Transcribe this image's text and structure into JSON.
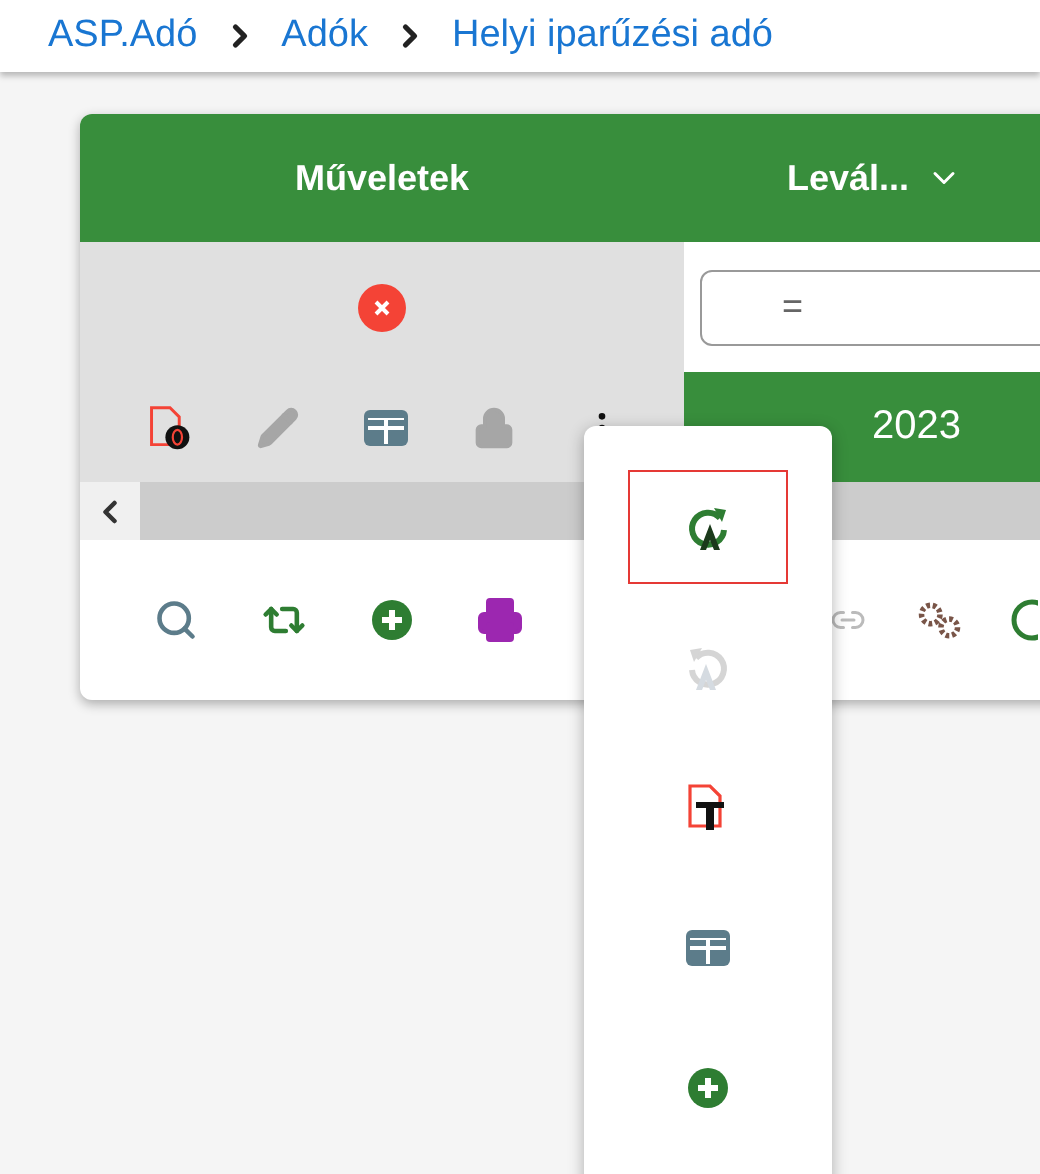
{
  "breadcrumb": [
    {
      "label": "ASP.Adó"
    },
    {
      "label": "Adók"
    },
    {
      "label": "Helyi iparűzési adó"
    }
  ],
  "table": {
    "columns": [
      {
        "label": "Műveletek"
      },
      {
        "label": "Levál..."
      }
    ],
    "row_actions": [
      {
        "kind": "pdf",
        "disabled": false
      },
      {
        "kind": "edit",
        "disabled": true
      },
      {
        "kind": "table",
        "disabled": false
      },
      {
        "kind": "lock",
        "disabled": true
      },
      {
        "kind": "more",
        "disabled": false
      }
    ],
    "filter": {
      "value": "="
    },
    "cell": "2023"
  },
  "toolbar": [
    {
      "kind": "search"
    },
    {
      "kind": "refresh"
    },
    {
      "kind": "add"
    },
    {
      "kind": "print"
    },
    {
      "kind": "link"
    },
    {
      "kind": "gears"
    },
    {
      "kind": "circle"
    }
  ],
  "menu": [
    {
      "kind": "redo",
      "selected": true,
      "disabled": false
    },
    {
      "kind": "undo",
      "selected": false,
      "disabled": true
    },
    {
      "kind": "pdf-text",
      "selected": false,
      "disabled": false
    },
    {
      "kind": "table",
      "selected": false,
      "disabled": false
    },
    {
      "kind": "add",
      "selected": false,
      "disabled": false
    }
  ]
}
